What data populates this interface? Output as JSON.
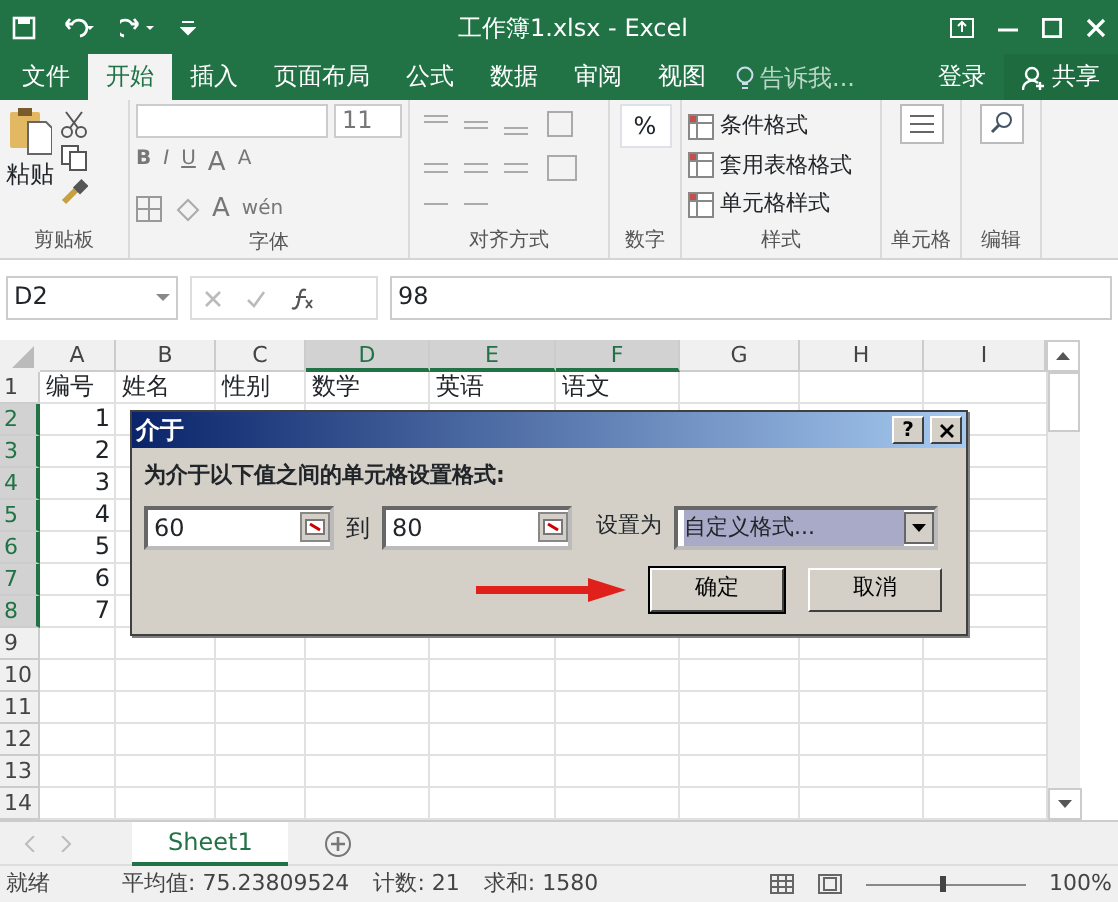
{
  "title_bar": {
    "title": "工作簿1.xlsx - Excel"
  },
  "ribbon_tabs": [
    {
      "label": "文件",
      "selected": false
    },
    {
      "label": "开始",
      "selected": true
    },
    {
      "label": "插入",
      "selected": false
    },
    {
      "label": "页面布局",
      "selected": false
    },
    {
      "label": "公式",
      "selected": false
    },
    {
      "label": "数据",
      "selected": false
    },
    {
      "label": "审阅",
      "selected": false
    },
    {
      "label": "视图",
      "selected": false
    }
  ],
  "tell_me": "告诉我...",
  "sign_in": "登录",
  "share": "共享",
  "ribbon": {
    "clipboard": {
      "paste": "粘贴",
      "label": "剪贴板"
    },
    "font": {
      "size": "11",
      "bold": "B",
      "italic": "I",
      "underline": "U",
      "grow": "A",
      "shrink": "A",
      "font_color_button": "A",
      "phonetic": "wén",
      "label": "字体"
    },
    "alignment": {
      "label": "对齐方式"
    },
    "number": {
      "symbol": "%",
      "label": "数字"
    },
    "styles": {
      "items": [
        "条件格式",
        "套用表格格式",
        "单元格样式"
      ],
      "label": "样式"
    },
    "cells": {
      "label": "单元格"
    },
    "editing": {
      "label": "编辑"
    }
  },
  "formula_bar": {
    "name_box": "D2",
    "value": "98"
  },
  "grid": {
    "columns": [
      {
        "label": "A",
        "selected": false
      },
      {
        "label": "B",
        "selected": false
      },
      {
        "label": "C",
        "selected": false
      },
      {
        "label": "D",
        "selected": true
      },
      {
        "label": "E",
        "selected": true
      },
      {
        "label": "F",
        "selected": true
      },
      {
        "label": "G",
        "selected": false
      },
      {
        "label": "H",
        "selected": false
      },
      {
        "label": "I",
        "selected": false
      }
    ],
    "rows": [
      {
        "number": "1",
        "selected": false,
        "cells": [
          "编号",
          "姓名",
          "性别",
          "数学",
          "英语",
          "语文"
        ]
      },
      {
        "number": "2",
        "selected": true,
        "cells": [
          "1"
        ]
      },
      {
        "number": "3",
        "selected": true,
        "cells": [
          "2"
        ]
      },
      {
        "number": "4",
        "selected": true,
        "cells": [
          "3"
        ]
      },
      {
        "number": "5",
        "selected": true,
        "cells": [
          "4"
        ]
      },
      {
        "number": "6",
        "selected": true,
        "cells": [
          "5"
        ]
      },
      {
        "number": "7",
        "selected": true,
        "cells": [
          "6"
        ]
      },
      {
        "number": "8",
        "selected": true,
        "cells": [
          "7"
        ]
      },
      {
        "number": "9",
        "selected": false,
        "cells": []
      },
      {
        "number": "10",
        "selected": false,
        "cells": []
      },
      {
        "number": "11",
        "selected": false,
        "cells": []
      },
      {
        "number": "12",
        "selected": false,
        "cells": []
      },
      {
        "number": "13",
        "selected": false,
        "cells": []
      },
      {
        "number": "14",
        "selected": false,
        "cells": []
      }
    ]
  },
  "dialog": {
    "title": "介于",
    "help": "?",
    "prompt": "为介于以下值之间的单元格设置格式:",
    "from": "60",
    "to_label": "到",
    "to": "80",
    "format_label": "设置为",
    "format": "自定义格式...",
    "buttons": [
      {
        "label": "确定",
        "default": true
      },
      {
        "label": "取消",
        "default": false
      }
    ]
  },
  "sheet_tabs": [
    {
      "label": "Sheet1",
      "selected": true
    }
  ],
  "status_bar": {
    "ready": "就绪",
    "average": "平均值: 75.23809524",
    "count": "计数: 21",
    "sum": "求和: 1580",
    "zoom_slider": {
      "level": 0.48
    },
    "zoom": "100%"
  }
}
